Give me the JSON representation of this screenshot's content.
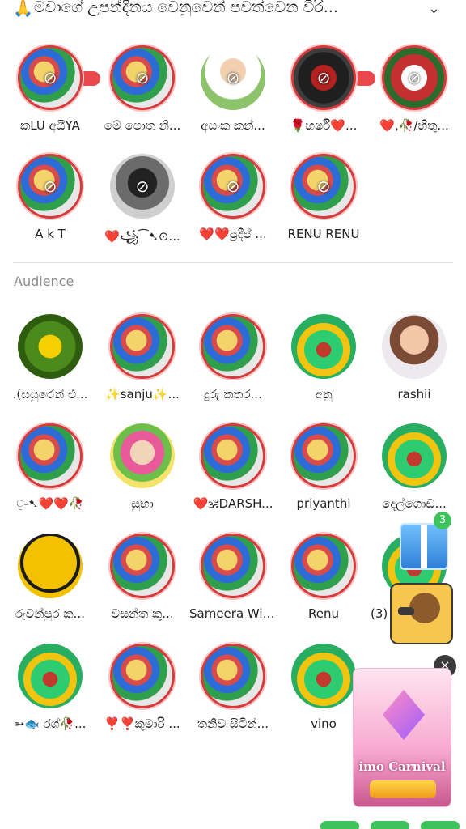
{
  "header": {
    "emoji": "🙏",
    "title": "මවාගේ උපන්දිනය වෙනුවෙන් පවත්වෙන විරි...",
    "chevron_icon": "chevron-down-icon"
  },
  "speakers": [
    {
      "name": "කLU අයීYA"
    },
    {
      "name": "මේ පොත නි..."
    },
    {
      "name": "අසංක කන්..."
    },
    {
      "name": "🌹හර්ෂි❤️..."
    },
    {
      "name": "❤️,🥀/හිතු..."
    },
    {
      "name": "A k T"
    },
    {
      "name": "❤️꧁⁀➷⊙..."
    },
    {
      "name": "❤️❤️ප්‍රදීප් ..."
    },
    {
      "name": "RENU RENU"
    }
  ],
  "audience_label": "Audience",
  "audience": [
    {
      "name": ".(සයුරෙන් එ..."
    },
    {
      "name": "✨sanju✨..."
    },
    {
      "name": "දුරු කතර..."
    },
    {
      "name": "අනු"
    },
    {
      "name": "rashii"
    },
    {
      "name": "⍜-➷❤️❤️🥀"
    },
    {
      "name": "සුභා"
    },
    {
      "name": "❤️🕉DARSH..."
    },
    {
      "name": "priyanthi"
    },
    {
      "name": "දෙල්ගොඩ..."
    },
    {
      "name": "රුවන්පුර ක..."
    },
    {
      "name": "වසන්ත කු..."
    },
    {
      "name": "Sameera Wij..."
    },
    {
      "name": "Renu"
    },
    {
      "name": "(3)"
    },
    {
      "name": "➳🐟 රශ්🥀..."
    },
    {
      "name": "❣️❣️කුමාරි ..."
    },
    {
      "name": "තනිව සිටින්..."
    },
    {
      "name": "vino"
    }
  ],
  "gift_badge": {
    "count": "3",
    "icon": "gift-icon"
  },
  "promo": {
    "title": "imo Carnival",
    "close_icon": "close-icon"
  }
}
